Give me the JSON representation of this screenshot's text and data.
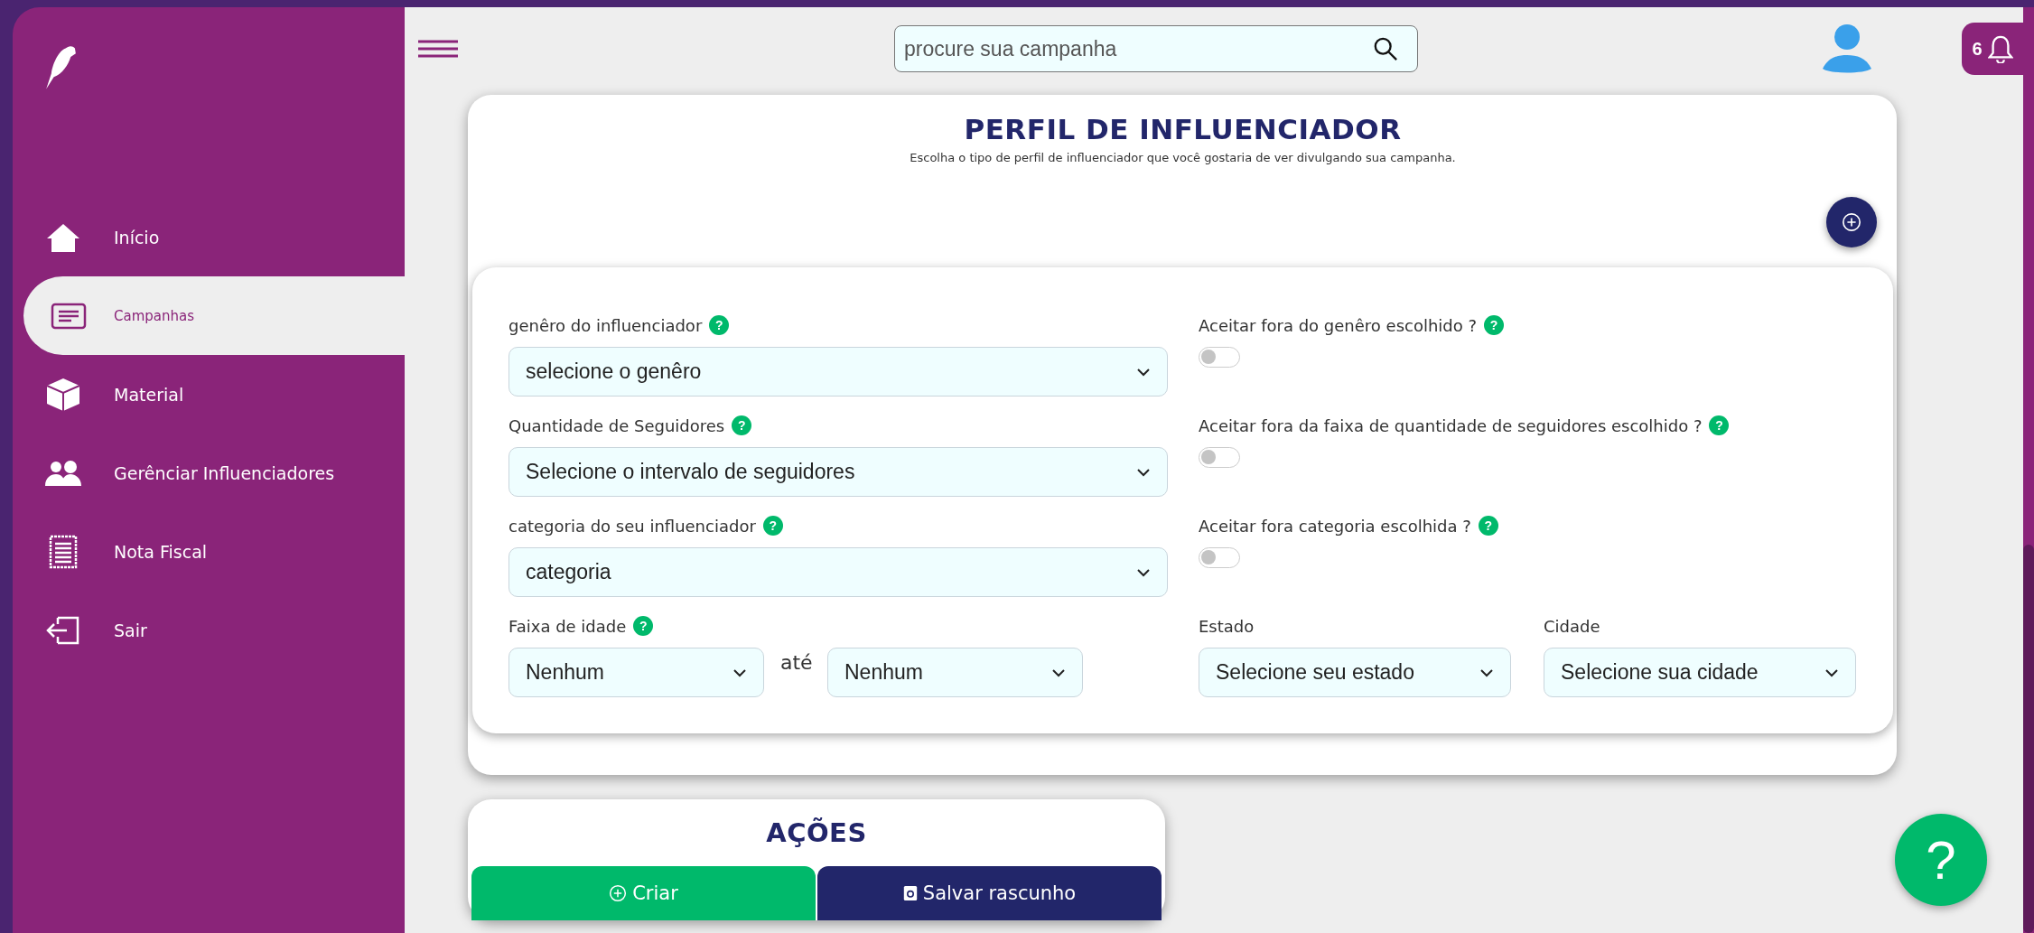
{
  "sidebar": {
    "items": [
      {
        "label": "Início",
        "kind": "home",
        "selected": false
      },
      {
        "label": "Campanhas",
        "kind": "list",
        "selected": true
      },
      {
        "label": "Material",
        "kind": "box",
        "selected": false
      },
      {
        "label": "Gerênciar Influenciadores",
        "kind": "people",
        "selected": false
      },
      {
        "label": "Nota Fiscal",
        "kind": "receipt",
        "selected": false
      },
      {
        "label": "Sair",
        "kind": "exit",
        "selected": false
      }
    ]
  },
  "header": {
    "search": {
      "placeholder": "procure sua campanha"
    },
    "notifications": {
      "count": "6"
    }
  },
  "profile": {
    "title": "PERFIL DE INFLUENCIADOR",
    "subtitle": "Escolha o tipo de perfil de influenciador que você gostaria de ver divulgando sua campanha.",
    "fields": [
      {
        "label": "genêro do influenciador",
        "help": "?",
        "value": "selecione o genêro"
      },
      {
        "label": "Quantidade de Seguidores",
        "help": "?",
        "value": "Selecione o intervalo de seguidores"
      },
      {
        "label": "categoria do seu influenciador",
        "help": "?",
        "value": "categoria"
      }
    ],
    "toggles": [
      {
        "label": "Aceitar fora do genêro escolhido ?",
        "help": "?",
        "on": false
      },
      {
        "label": "Aceitar fora da faixa de quantidade de seguidores escolhido ?",
        "help": "?",
        "on": false
      },
      {
        "label": "Aceitar fora categoria escolhida ?",
        "help": "?",
        "on": false
      }
    ],
    "age_range": {
      "label": "Faixa de idade",
      "help": "?",
      "from": "Nenhum",
      "separator": "até",
      "to": "Nenhum"
    },
    "location": [
      {
        "label": "Estado",
        "value": "Selecione seu estado"
      },
      {
        "label": "Cidade",
        "value": "Selecione sua cidade"
      }
    ]
  },
  "actions": {
    "title": "AÇÕES",
    "buttons": [
      {
        "label": "Criar",
        "kind": "primary"
      },
      {
        "label": "Salvar rascunho",
        "kind": "secondary"
      }
    ]
  },
  "help_button": {
    "label": "?"
  }
}
